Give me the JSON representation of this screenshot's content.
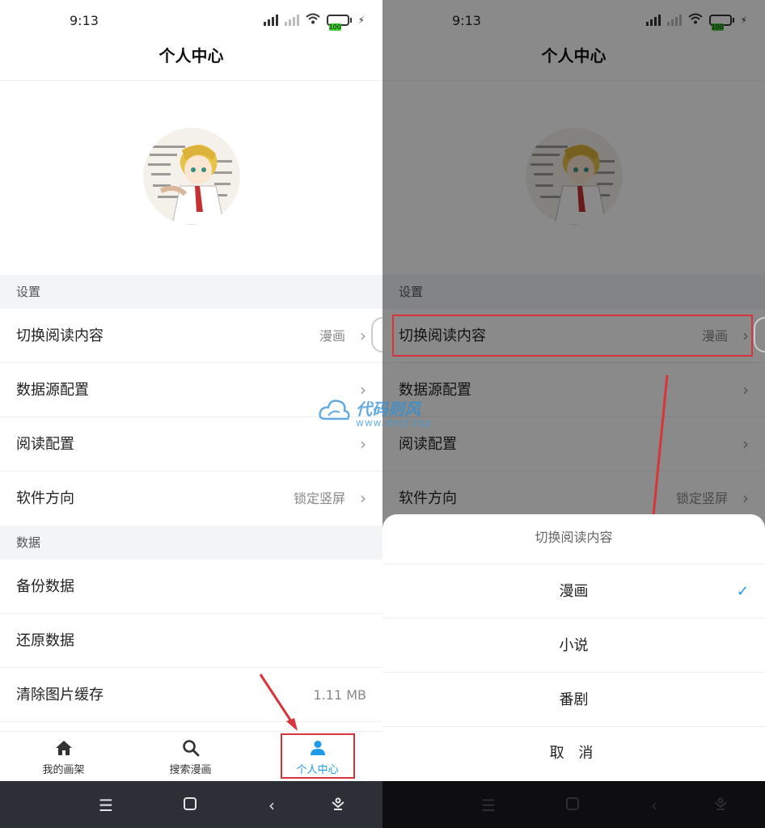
{
  "status": {
    "time": "9:13",
    "battery": "100"
  },
  "header": {
    "title": "个人中心"
  },
  "sections": {
    "settings_label": "设置",
    "data_label": "数据"
  },
  "rows": {
    "read_content": {
      "label": "切换阅读内容",
      "value": "漫画"
    },
    "source_config": {
      "label": "数据源配置"
    },
    "read_config": {
      "label": "阅读配置"
    },
    "orientation": {
      "label": "软件方向",
      "value": "锁定竖屏"
    },
    "backup": {
      "label": "备份数据"
    },
    "restore": {
      "label": "还原数据"
    },
    "clear_cache": {
      "label": "清除图片缓存",
      "value": "1.11 MB"
    }
  },
  "nav": {
    "items": [
      {
        "label": "我的画架",
        "icon": "home-icon"
      },
      {
        "label": "搜索漫画",
        "icon": "search-icon"
      },
      {
        "label": "个人中心",
        "icon": "person-icon",
        "active": true
      }
    ]
  },
  "sheet": {
    "title": "切换阅读内容",
    "options": [
      {
        "label": "漫画",
        "selected": true
      },
      {
        "label": "小说"
      },
      {
        "label": "番剧"
      }
    ],
    "cancel": "取 消"
  },
  "watermark": {
    "name": "代码则风",
    "url": "www.dmjf.top"
  },
  "colors": {
    "accent": "#1e9be6",
    "annotation": "#d9343a"
  }
}
